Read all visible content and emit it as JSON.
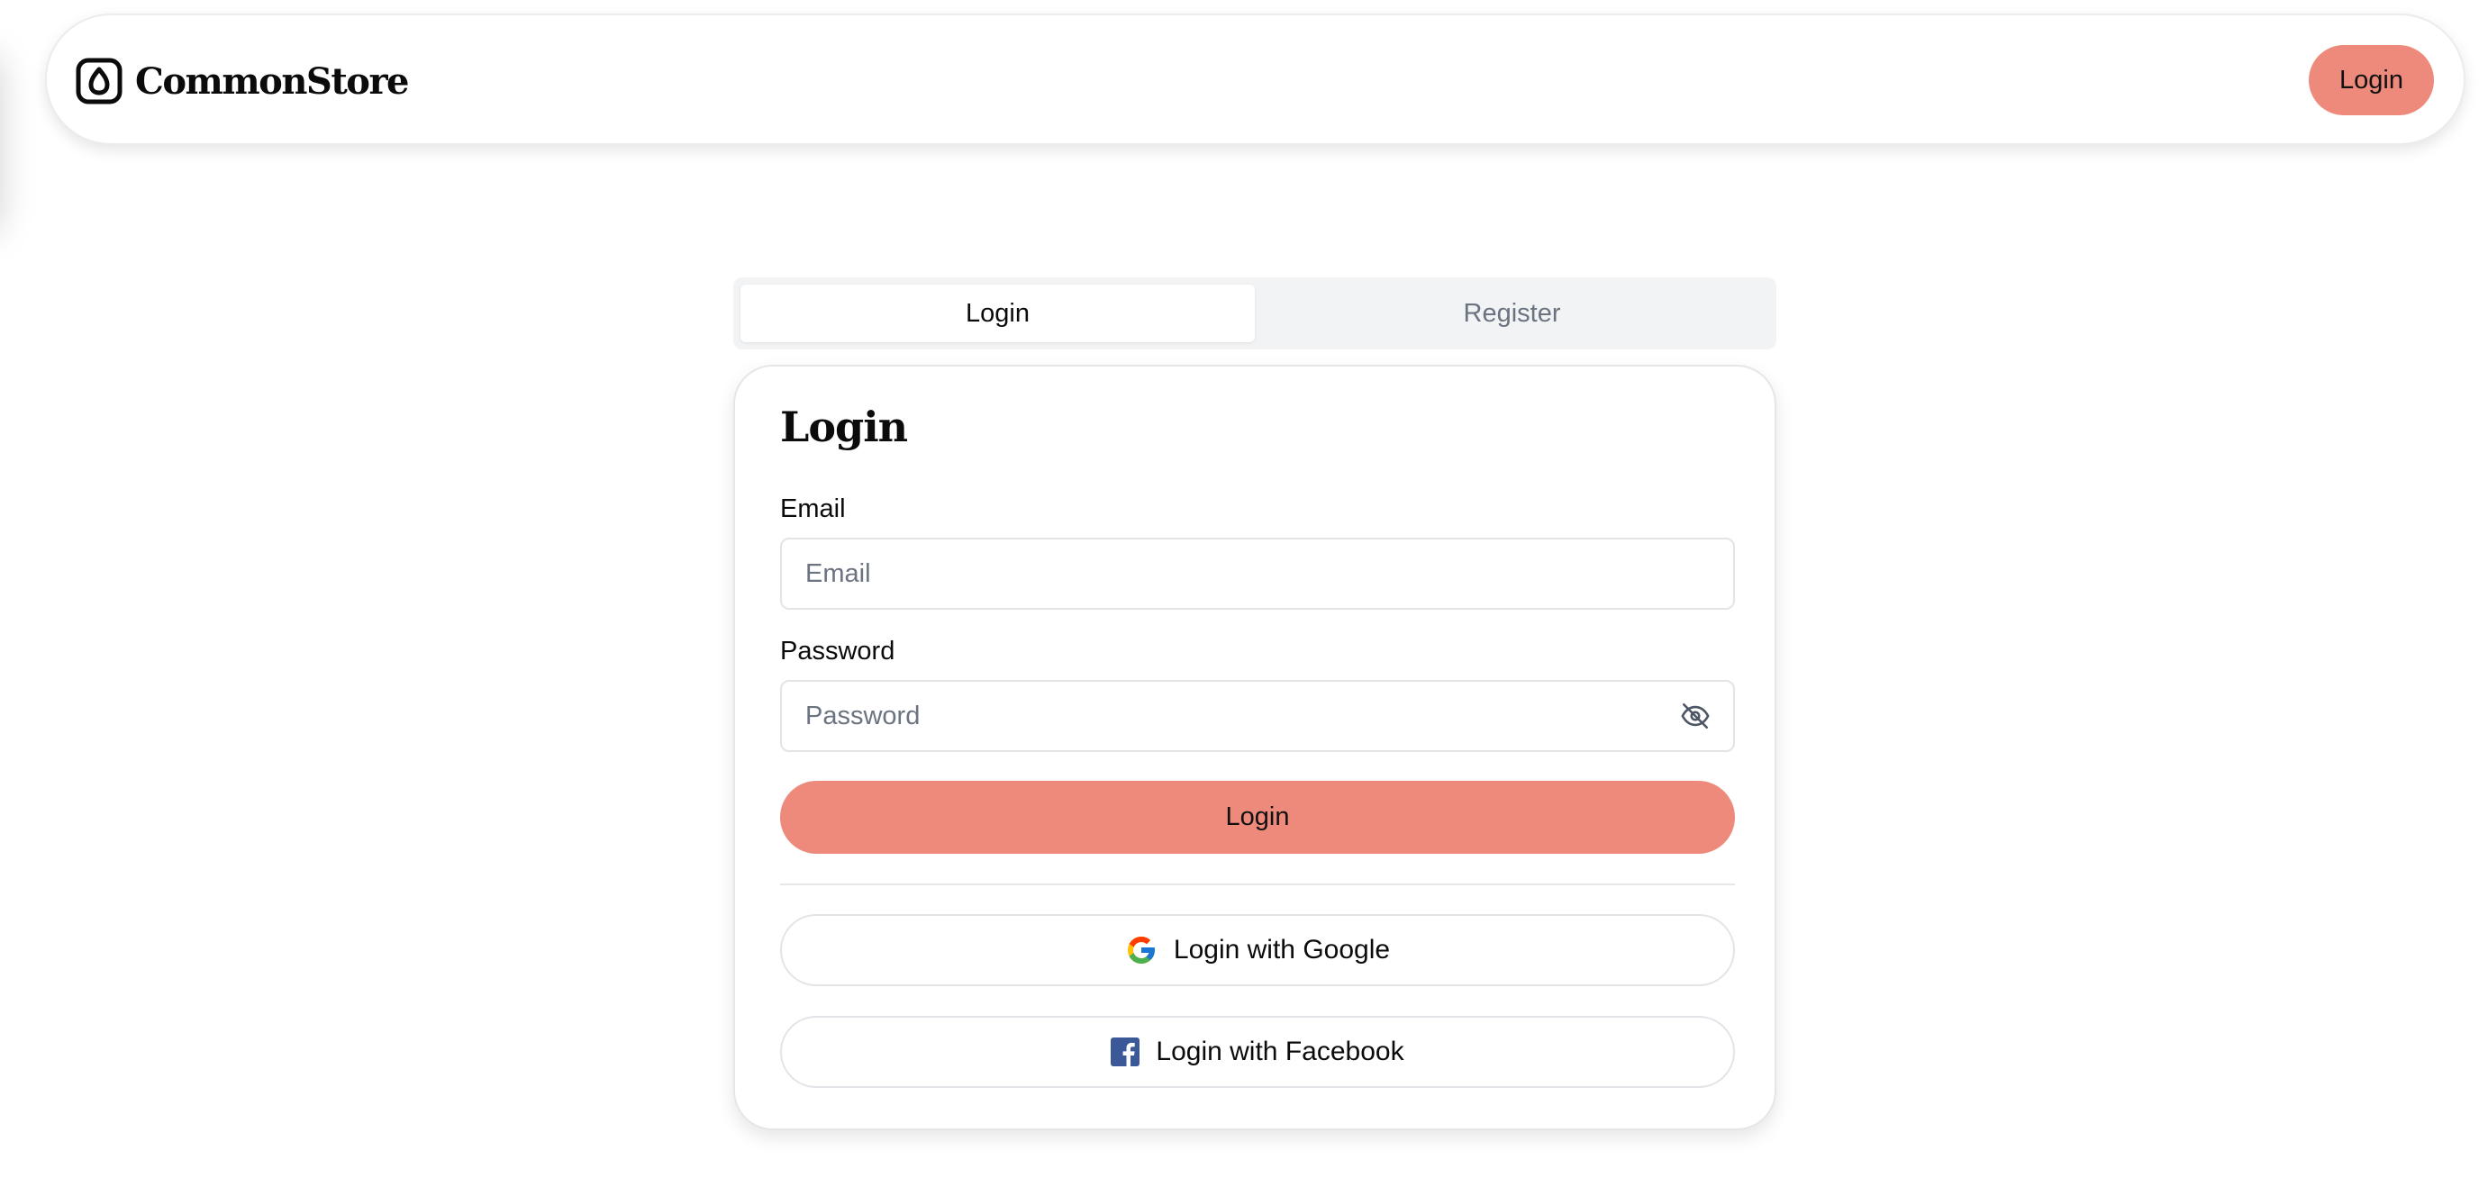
{
  "header": {
    "brand": "CommonStore",
    "login_label": "Login"
  },
  "tabs": [
    {
      "label": "Login",
      "active": true
    },
    {
      "label": "Register",
      "active": false
    }
  ],
  "form": {
    "title": "Login",
    "email": {
      "label": "Email",
      "placeholder": "Email",
      "value": ""
    },
    "password": {
      "label": "Password",
      "placeholder": "Password",
      "value": "",
      "toggle_icon": "eye-off-icon"
    },
    "submit_label": "Login",
    "google_label": "Login with Google",
    "facebook_label": "Login with Facebook"
  },
  "colors": {
    "accent": "#ed8a7b",
    "facebook": "#3b5998",
    "tab_background": "#f2f3f5",
    "muted_text": "#6b7280"
  }
}
